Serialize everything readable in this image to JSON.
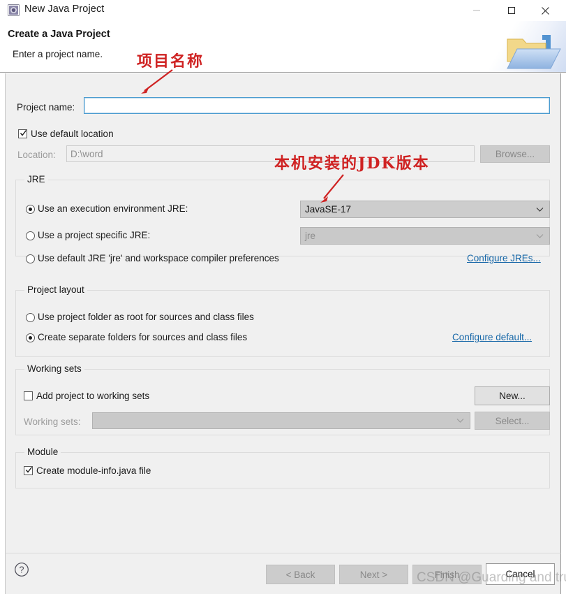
{
  "window": {
    "title": "New Java Project",
    "icon": "java-project-icon",
    "controls": {
      "minimize": "minimize-icon",
      "maximize": "maximize-icon",
      "close": "close-icon"
    }
  },
  "header": {
    "title": "Create a Java Project",
    "subtitle": "Enter a project name.",
    "banner_icon": "java-folder-banner-icon"
  },
  "form": {
    "project_name_label": "Project name:",
    "project_name_value": "",
    "project_name_placeholder": "",
    "use_default_location_label": "Use default location",
    "use_default_location_checked": true,
    "location_label": "Location:",
    "location_value": "D:\\word",
    "browse_label": "Browse..."
  },
  "jre": {
    "group_title": "JRE",
    "option_execution_env": "Use an execution environment JRE:",
    "execution_env_value": "JavaSE-17",
    "option_project_specific": "Use a project specific JRE:",
    "project_specific_value": "jre",
    "option_default_jre": "Use default JRE 'jre' and workspace compiler preferences",
    "configure_link": "Configure JREs...",
    "selected": "execution_env"
  },
  "project_layout": {
    "group_title": "Project layout",
    "option_project_folder_root": "Use project folder as root for sources and class files",
    "option_separate_folders": "Create separate folders for sources and class files",
    "configure_link": "Configure default...",
    "selected": "separate_folders"
  },
  "working_sets": {
    "group_title": "Working sets",
    "add_project_label": "Add project to working sets",
    "add_project_checked": false,
    "new_label": "New...",
    "working_sets_label": "Working sets:",
    "working_sets_value": "",
    "select_label": "Select..."
  },
  "module": {
    "group_title": "Module",
    "create_module_info_label": "Create module-info.java file",
    "create_module_info_checked": true
  },
  "footer": {
    "help_icon": "help-icon",
    "back_label": "< Back",
    "next_label": "Next >",
    "finish_label": "Finish",
    "cancel_label": "Cancel"
  },
  "annotations": {
    "project_name_note": "项目名称",
    "jdk_version_note": "本机安装的JDK版本",
    "arrow_color": "#cf2222"
  },
  "watermark": {
    "text": "CSDN @Guarding and trust"
  },
  "colors": {
    "link": "#1667a8",
    "accent_focus": "#4b9cd0",
    "dialog_bg": "#f0f0f0",
    "annotation_red": "#cf2222"
  }
}
